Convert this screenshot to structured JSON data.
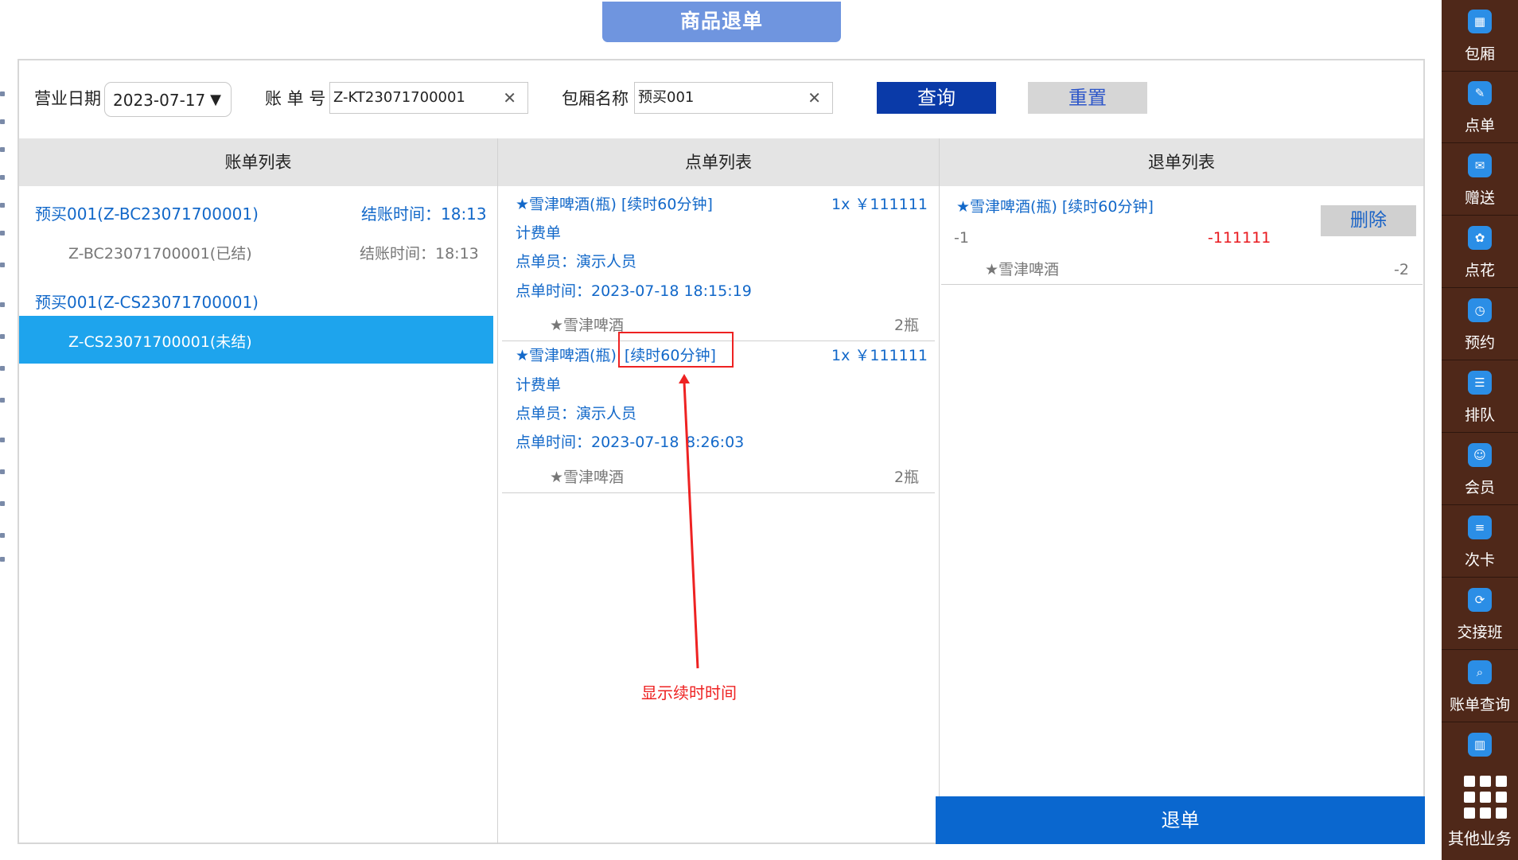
{
  "title": "商品退单",
  "search": {
    "date_label": "营业日期",
    "date_value": "2023-07-17",
    "bill_label": "账 单 号",
    "bill_value": "Z-KT23071700001",
    "room_label": "包厢名称",
    "room_value": "预买001",
    "query_button": "查询",
    "reset_button": "重置"
  },
  "columns": {
    "bills": "账单列表",
    "orders": "点单列表",
    "refunds": "退单列表"
  },
  "bills": [
    {
      "title": "预买001(Z-BC23071700001)",
      "time": "结账时间：18:13",
      "sub": "Z-BC23071700001(已结)",
      "sub_time": "结账时间：18:13"
    },
    {
      "title": "预买001(Z-CS23071700001)",
      "sub": "Z-CS23071700001(未结)"
    }
  ],
  "orders": [
    {
      "name": "★雪津啤酒(瓶) [续时60分钟]",
      "qty_price": "1x ￥111111",
      "type": "计费单",
      "staff": "点单员：演示人员",
      "time": "点单时间：2023-07-18 18:15:19",
      "item": "★雪津啤酒",
      "item_qty": "2瓶"
    },
    {
      "name_prefix": "★雪津啤酒(瓶)",
      "name_tag": "[续时60分钟]",
      "qty_price": "1x ￥111111",
      "type": "计费单",
      "staff": "点单员：演示人员",
      "time_a": "点单时间：2023-07-18",
      "time_b": "8:26:03",
      "item": "★雪津啤酒",
      "item_qty": "2瓶"
    }
  ],
  "refunds": [
    {
      "name": "★雪津啤酒(瓶) [续时60分钟]",
      "qty": "-1",
      "amount": "-111111",
      "delete_button": "删除",
      "item": "★雪津啤酒",
      "item_qty": "-2"
    }
  ],
  "refund_button": "退单",
  "annotation": "显示续时时间",
  "right_nav": [
    {
      "label": "包厢",
      "icon": "room-grid-icon"
    },
    {
      "label": "点单",
      "icon": "order-glass-icon"
    },
    {
      "label": "赠送",
      "icon": "gift-icon"
    },
    {
      "label": "点花",
      "icon": "flower-icon"
    },
    {
      "label": "预约",
      "icon": "reservation-icon"
    },
    {
      "label": "排队",
      "icon": "queue-icon"
    },
    {
      "label": "会员",
      "icon": "member-icon"
    },
    {
      "label": "次卡",
      "icon": "card-icon"
    },
    {
      "label": "交接班",
      "icon": "shift-icon"
    },
    {
      "label": "账单查询",
      "icon": "bill-search-icon"
    },
    {
      "label": "",
      "icon": "report-chart-icon"
    }
  ],
  "more_label": "其他业务",
  "colors": {
    "accent_blue": "#1268c9",
    "selected_row": "#1ea4ed",
    "query_button": "#0a3aa8",
    "refund_button": "#0a67cf",
    "title_tab": "#6f95df",
    "annotation_red": "#ee2222",
    "sidebar_wood": "#4a2618"
  }
}
